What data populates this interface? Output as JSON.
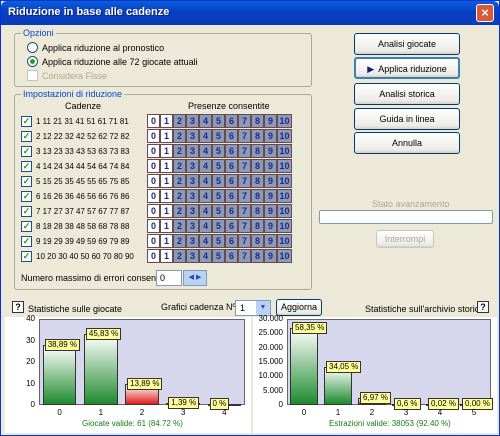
{
  "window": {
    "title": "Riduzione in base alle cadenze",
    "close_glyph": "×"
  },
  "options": {
    "title": "Opzioni",
    "radio1": "Applica riduzione al pronostico",
    "radio2": "Applica riduzione alle 72 giocate attuali",
    "checkbox": "Considera Fisse"
  },
  "reduction": {
    "title": "Impostazioni di riduzione",
    "col_cadenze": "Cadenze",
    "col_presenze": "Presenze consentite",
    "rows": [
      "1 11 21 31 41 51 61 71 81",
      "2 12 22 32 42 52 62 72 82",
      "3 13 23 33 43 53 63 73 83",
      "4 14 24 34 44 54 64 74 84",
      "5 15 25 35 45 55 65 75 85",
      "6 16 26 36 46 56 66 76 86",
      "7 17 27 37 47 57 67 77 87",
      "8 18 28 38 48 58 68 78 88",
      "9 19 29 39 49 59 69 79 89",
      "10 20 30 40 50 60 70 80 90"
    ],
    "check_glyph": "✓",
    "presenze": [
      "0",
      "1",
      "2",
      "3",
      "4",
      "5",
      "6",
      "7",
      "8",
      "9",
      "10"
    ],
    "max_errors_label": "Numero massimo di errori consentiti:",
    "max_errors_value": "0",
    "spin_glyph": "◀ ▶"
  },
  "buttons": {
    "analisi_giocate": "Analisi giocate",
    "applica_riduzione": "Applica riduzione",
    "applica_arrow": "▶",
    "analisi_storica": "Analisi storica",
    "guida": "Guida in linea",
    "annulla": "Annulla",
    "interrompi": "Interrompi"
  },
  "progress": {
    "label": "Stato avanzamento",
    "value": 0
  },
  "stats": {
    "left_title": "Statistiche sulle giocate",
    "right_title": "Statistiche sull'archivio storico",
    "help_glyph": "?",
    "chart_select_label": "Grafici cadenza Nº",
    "chart_select_value": "1",
    "dropdown_glyph": "▼",
    "aggiorna": "Aggiorna"
  },
  "colors": {
    "green": "#1e8a2e",
    "red": "#e01c1c",
    "plot_bg": "#d6d6ec",
    "label_bg": "#ffff99"
  },
  "chart_data": [
    {
      "type": "bar",
      "categories": [
        "0",
        "1",
        "2",
        "3",
        "4"
      ],
      "values": [
        38.89,
        45.83,
        13.89,
        1.39,
        0
      ],
      "counts": [
        28,
        33,
        10,
        1,
        0
      ],
      "labels": [
        "38,89 %",
        "45,83 %",
        "13,89 %",
        "1,39 %",
        "0 %"
      ],
      "y_ticks": [
        "0",
        "10",
        "20",
        "30",
        "40"
      ],
      "ylim": [
        0,
        40
      ],
      "footer": "Giocate valide: 61 (84.72 %)"
    },
    {
      "type": "bar",
      "categories": [
        "0",
        "1",
        "2",
        "3",
        "4",
        "5"
      ],
      "values": [
        58.35,
        34.05,
        6.97,
        0.6,
        0.02,
        0
      ],
      "counts": [
        28800,
        14000,
        2700,
        230,
        8,
        0
      ],
      "labels": [
        "58,35 %",
        "34,05 %",
        "6,97 %",
        "0,6 %",
        "0,02 %",
        "0,00 %"
      ],
      "y_ticks": [
        "0",
        "5.000",
        "10.000",
        "15.000",
        "20.000",
        "25.000",
        "30.000"
      ],
      "ylim": [
        0,
        32000
      ],
      "footer": "Estrazioni valide: 38053 (92.40 %)"
    }
  ]
}
